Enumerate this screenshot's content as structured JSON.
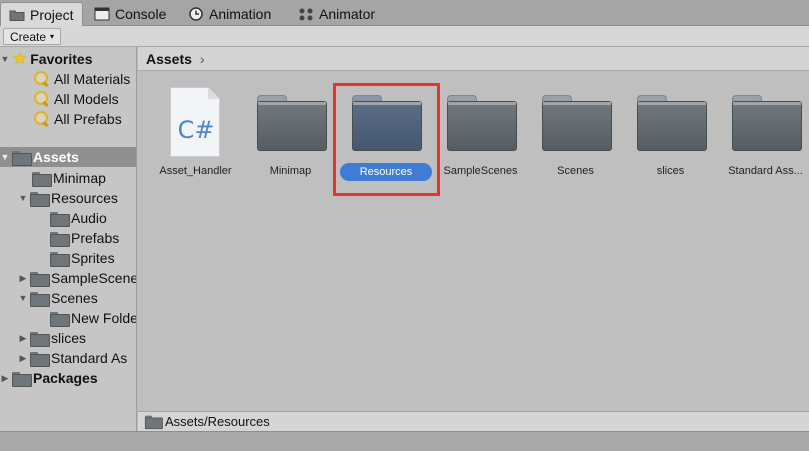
{
  "tabs": [
    {
      "label": "Project",
      "icon": "folder-icon",
      "active": true
    },
    {
      "label": "Console",
      "icon": "console-icon"
    },
    {
      "label": "Animation",
      "icon": "clock-icon"
    },
    {
      "label": "Animator",
      "icon": "animator-icon"
    }
  ],
  "toolbar": {
    "create_label": "Create",
    "caret": "▾"
  },
  "sidebar": {
    "favorites": {
      "label": "Favorites",
      "items": [
        "All Materials",
        "All Models",
        "All Prefabs"
      ]
    },
    "assets": {
      "label": "Assets",
      "minimap": "Minimap",
      "resources": "Resources",
      "resources_children": [
        "Audio",
        "Prefabs",
        "Sprites"
      ],
      "samplescenes": "SampleScene",
      "scenes": "Scenes",
      "scenes_children": [
        "New Folde"
      ],
      "slices": "slices",
      "standard": "Standard As"
    },
    "packages": "Packages"
  },
  "main": {
    "breadcrumb": "Assets",
    "breadcrumb_chevron": "›",
    "items": [
      {
        "label": "Asset_Handler",
        "type": "script",
        "icon_text": "C#"
      },
      {
        "label": "Minimap",
        "type": "folder"
      },
      {
        "label": "Resources",
        "type": "folder",
        "selected": true
      },
      {
        "label": "SampleScenes",
        "type": "folder"
      },
      {
        "label": "Scenes",
        "type": "folder"
      },
      {
        "label": "slices",
        "type": "folder"
      },
      {
        "label": "Standard Ass...",
        "type": "folder"
      }
    ]
  },
  "pathbar": {
    "path": "Assets/Resources"
  },
  "colors": {
    "selection": "#3f7cd6",
    "highlight_box": "#e7352b"
  }
}
